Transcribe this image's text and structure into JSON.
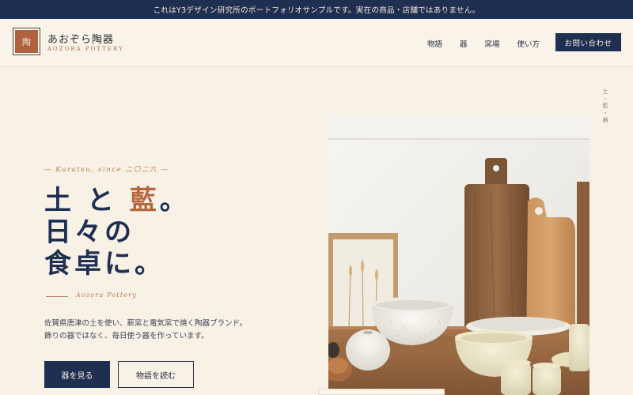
{
  "notice": "これはY3デザイン研究所のポートフォリオサンプルです。実在の商品・店舗ではありません。",
  "brand": {
    "mark": "陶",
    "name": "あおぞら陶器",
    "sub": "AOZORA POTTERY"
  },
  "nav": {
    "items": [
      "物語",
      "器",
      "窯場",
      "使い方"
    ],
    "contact": "お問い合わせ"
  },
  "side_note": "土・藍・器",
  "hero": {
    "eyebrow": "— Karatsu, since 二〇二六 —",
    "headline": {
      "line1_a": "土 と ",
      "line1_accent": "藍",
      "line1_b": "。",
      "line2": "日々の",
      "line3": "食卓に。"
    },
    "signature": "Aozora Pottery",
    "desc_line1": "佐賀県唐津の土を使い、薪窯と電気窯で焼く陶器ブランド。",
    "desc_line2": "飾りの器ではなく、毎日使う器を作っています。",
    "primary_button": "器を見る",
    "secondary_button": "物語を読む"
  },
  "colors": {
    "navy": "#1f2f52",
    "terracotta": "#b5683f",
    "cream": "#f8f1e6"
  }
}
